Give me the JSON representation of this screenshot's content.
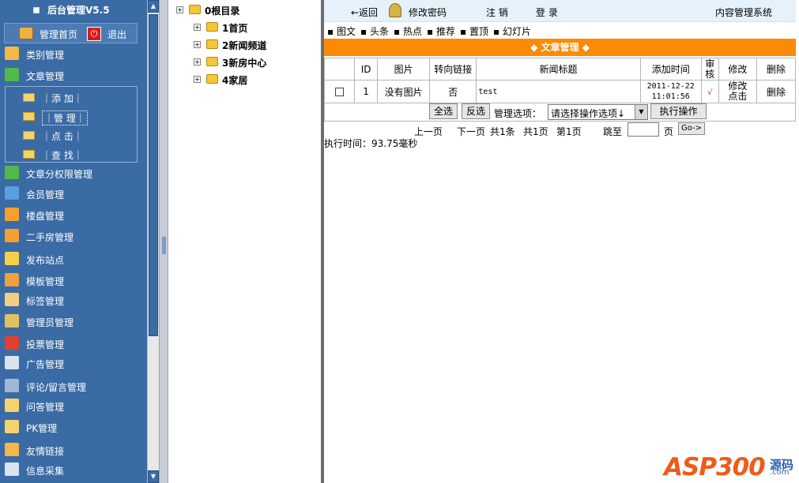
{
  "sidebar": {
    "title": "后台管理V5.5",
    "home_label": "管理首页",
    "logout_label": "退出",
    "items": [
      {
        "label": "类别管理",
        "icon": "category-icon",
        "color": "#f2b84a"
      },
      {
        "label": "文章管理",
        "icon": "article-icon",
        "color": "#54b84a"
      },
      {
        "label": "文章分权限管理",
        "icon": "permission-icon",
        "color": "#54b84a"
      },
      {
        "label": "会员管理",
        "icon": "members-icon",
        "color": "#58a0e0"
      },
      {
        "label": "楼盘管理",
        "icon": "house-icon",
        "color": "#f5a030"
      },
      {
        "label": "二手房管理",
        "icon": "house-icon",
        "color": "#f5a030"
      },
      {
        "label": "发布站点",
        "icon": "publish-icon",
        "color": "#f4d04a"
      },
      {
        "label": "模板管理",
        "icon": "template-icon",
        "color": "#f0a040"
      },
      {
        "label": "标签管理",
        "icon": "tag-icon",
        "color": "#f0d080"
      },
      {
        "label": "管理员管理",
        "icon": "admin-icon",
        "color": "#e0c060"
      },
      {
        "label": "投票管理",
        "icon": "vote-icon",
        "color": "#e04030"
      },
      {
        "label": "广告管理",
        "icon": "ad-icon",
        "color": "#d8e4f0"
      },
      {
        "label": "评论/留言管理",
        "icon": "comment-icon",
        "color": "#a0b8d8"
      },
      {
        "label": "问答管理",
        "icon": "folder-icon",
        "color": "#f5d36b"
      },
      {
        "label": "PK管理",
        "icon": "folder-icon",
        "color": "#f5d36b"
      },
      {
        "label": "友情链接",
        "icon": "link-icon",
        "color": "#f2b84a"
      },
      {
        "label": "信息采集",
        "icon": "collect-icon",
        "color": "#d8e4f0"
      }
    ],
    "sub_items": [
      "｜添 加｜",
      "｜管 理｜",
      "｜点 击｜",
      "｜查 找｜"
    ]
  },
  "tree": {
    "root": "0根目录",
    "nodes": [
      "1首页",
      "2新闻频道",
      "3新房中心",
      "4家居"
    ]
  },
  "topbar": {
    "back": "←返回",
    "change_password": "修改密码",
    "logout": "注 销",
    "login": "登 录",
    "system": "内容管理系统"
  },
  "flags": [
    "▪ 图文",
    "▪ 头条",
    "▪ 热点",
    "▪ 推荐",
    "▪ 置顶",
    "▪ 幻灯片"
  ],
  "article_header": "◆ 文章管理 ◆",
  "table": {
    "headers": [
      "",
      "ID",
      "图片",
      "转向链接",
      "新闻标题",
      "添加时间",
      "审核",
      "修改",
      "删除"
    ],
    "rows": [
      {
        "id": "1",
        "image": "没有图片",
        "redirect": "否",
        "title": "test",
        "date": "2011-12-22",
        "time": "11:01:56",
        "approved": "√",
        "edit": "修改",
        "edit2": "点击",
        "delete": "删除"
      }
    ]
  },
  "ops": {
    "select_all": "全选",
    "invert": "反选",
    "label": "管理选项：",
    "select_value": "请选择操作选项↓",
    "execute": "执行操作"
  },
  "pager": {
    "prev": "上一页",
    "next": "下一页",
    "total": "共1条",
    "pages": "共1页",
    "current": "第1页",
    "jump": "跳至",
    "unit": "页",
    "go": "Go->"
  },
  "exec_time": "执行时间：93.75毫秒",
  "brand": {
    "name": "ASP300",
    "tag": "源码",
    "domain": ".com"
  }
}
